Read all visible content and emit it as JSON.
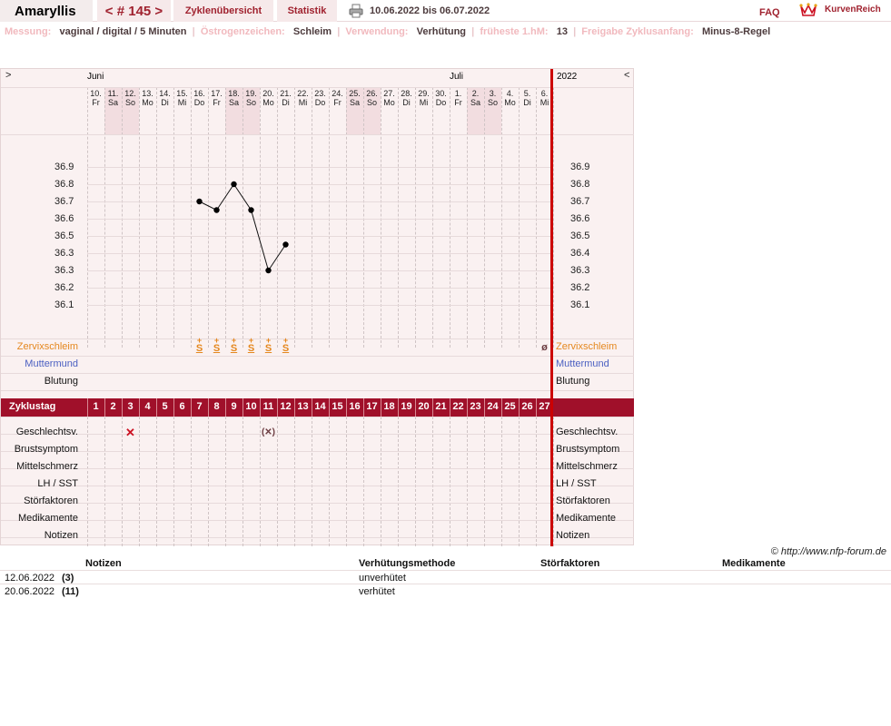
{
  "header": {
    "username": "Amaryllis",
    "cycle_label": "< # 145 >",
    "tab_overview": "Zyklenübersicht",
    "tab_statistics": "Statistik",
    "print_icon": "printer-icon",
    "date_range": "10.06.2022 bis 06.07.2022",
    "faq": "FAQ",
    "brand": "KurvenReich",
    "brand_icon": "crown-icon"
  },
  "info": {
    "measurement_label": "Messung:",
    "measurement_value": "vaginal / digital / 5 Minuten",
    "estrogen_label": "Östrogenzeichen:",
    "estrogen_value": "Schleim",
    "usage_label": "Verwendung:",
    "usage_value": "Verhütung",
    "earliest_label": "früheste 1.hM:",
    "earliest_value": "13",
    "release_label": "Freigabe Zyklusanfang:",
    "release_value": "Minus-8-Regel"
  },
  "chart": {
    "nav_left": ">",
    "nav_right": "<",
    "year": "2022",
    "month_june": "Juni",
    "month_july": "Juli",
    "days": [
      {
        "d": "10.",
        "w": "Fr",
        "we": false
      },
      {
        "d": "11.",
        "w": "Sa",
        "we": true
      },
      {
        "d": "12.",
        "w": "So",
        "we": true
      },
      {
        "d": "13.",
        "w": "Mo",
        "we": false
      },
      {
        "d": "14.",
        "w": "Di",
        "we": false
      },
      {
        "d": "15.",
        "w": "Mi",
        "we": false
      },
      {
        "d": "16.",
        "w": "Do",
        "we": false
      },
      {
        "d": "17.",
        "w": "Fr",
        "we": false
      },
      {
        "d": "18.",
        "w": "Sa",
        "we": true
      },
      {
        "d": "19.",
        "w": "So",
        "we": true
      },
      {
        "d": "20.",
        "w": "Mo",
        "we": false
      },
      {
        "d": "21.",
        "w": "Di",
        "we": false
      },
      {
        "d": "22.",
        "w": "Mi",
        "we": false
      },
      {
        "d": "23.",
        "w": "Do",
        "we": false
      },
      {
        "d": "24.",
        "w": "Fr",
        "we": false
      },
      {
        "d": "25.",
        "w": "Sa",
        "we": true
      },
      {
        "d": "26.",
        "w": "So",
        "we": true
      },
      {
        "d": "27.",
        "w": "Mo",
        "we": false
      },
      {
        "d": "28.",
        "w": "Di",
        "we": false
      },
      {
        "d": "29.",
        "w": "Mi",
        "we": false
      },
      {
        "d": "30.",
        "w": "Do",
        "we": false
      },
      {
        "d": "1.",
        "w": "Fr",
        "we": false
      },
      {
        "d": "2.",
        "w": "Sa",
        "we": true
      },
      {
        "d": "3.",
        "w": "So",
        "we": true
      },
      {
        "d": "4.",
        "w": "Mo",
        "we": false
      },
      {
        "d": "5.",
        "w": "Di",
        "we": false
      },
      {
        "d": "6.",
        "w": "Mi",
        "we": false
      }
    ],
    "temp_ticks": [
      "36.9",
      "36.8",
      "36.7",
      "36.6",
      "36.5",
      "36.4",
      "36.3",
      "36.2",
      "36.1"
    ],
    "temp_ticks_left": [
      "36.9",
      "36.8",
      "36.7",
      "36.6",
      "36.5",
      "36.3",
      "36.3",
      "36.2",
      "36.1"
    ],
    "mucus_symbol": "S",
    "mucus_plus": "+",
    "mucus_days": [
      7,
      8,
      9,
      10,
      11,
      12
    ],
    "mucus_dry_day": 27,
    "mucus_dry_symbol": "ø",
    "row_mucus": "Zervixschleim",
    "row_cervix": "Muttermund",
    "row_bleeding": "Blutung",
    "row_cycleday": "Zyklustag",
    "rows_bottom": [
      "Geschlechtsv.",
      "Brustsymptom",
      "Mittelschmerz",
      "LH / SST",
      "Störfaktoren",
      "Medikamente",
      "Notizen"
    ],
    "intercourse": [
      {
        "day": 3,
        "symbol": "✕"
      },
      {
        "day": 11,
        "symbol": "(✕)"
      }
    ],
    "copyright": "© http://www.nfp-forum.de",
    "color_mucus": "#e5881f",
    "color_cervix": "#4a5fc1",
    "color_band": "#a0102a"
  },
  "chart_data": {
    "type": "line",
    "x": [
      7,
      8,
      9,
      10,
      11,
      12
    ],
    "values": [
      36.7,
      36.65,
      36.8,
      36.65,
      36.3,
      36.45
    ],
    "ylim": [
      36.0,
      37.0
    ],
    "xlabel": "Zyklustag",
    "cycle_days": [
      1,
      2,
      3,
      4,
      5,
      6,
      7,
      8,
      9,
      10,
      11,
      12,
      13,
      14,
      15,
      16,
      17,
      18,
      19,
      20,
      21,
      22,
      23,
      24,
      25,
      26,
      27
    ]
  },
  "notes": {
    "headers": {
      "notes": "Notizen",
      "method": "Verhütungsmethode",
      "factors": "Störfaktoren",
      "meds": "Medikamente"
    },
    "rows": [
      {
        "date": "12.06.2022",
        "day": "(3)",
        "method": "unverhütet"
      },
      {
        "date": "20.06.2022",
        "day": "(11)",
        "method": "verhütet"
      }
    ]
  }
}
